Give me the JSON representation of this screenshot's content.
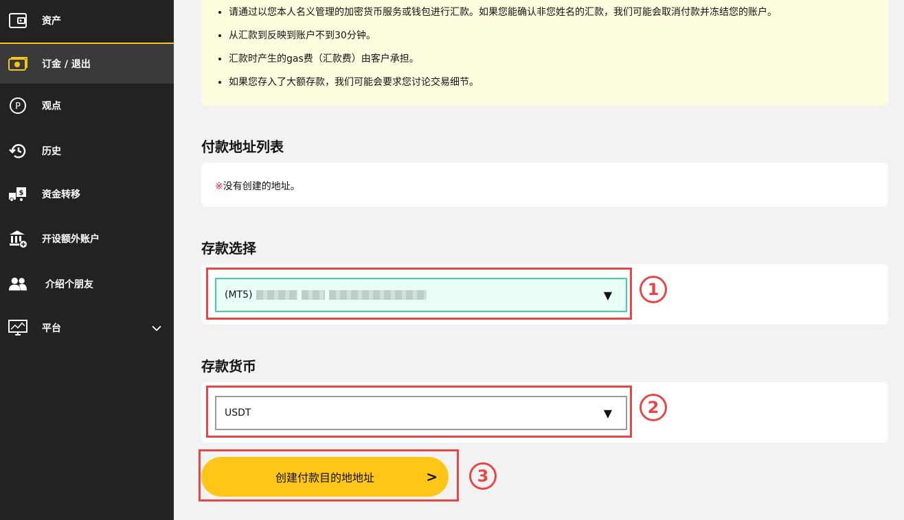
{
  "sidebar": {
    "items": [
      {
        "label": "资产",
        "icon": "wallet-icon"
      },
      {
        "label": "订金 / 退出",
        "icon": "cash-icon"
      },
      {
        "label": "观点",
        "icon": "points-icon"
      },
      {
        "label": "历史",
        "icon": "history-icon"
      },
      {
        "label": "资金转移",
        "icon": "transfer-icon"
      },
      {
        "label": "开设额外账户",
        "icon": "bank-icon"
      },
      {
        "label": "介绍个朋友",
        "icon": "users-icon"
      },
      {
        "label": "平台",
        "icon": "monitor-icon"
      }
    ],
    "active_color": "#f5c518"
  },
  "notice": {
    "items": [
      "请通过以您本人名义管理的加密货币服务或钱包进行汇款。如果您能确认非您姓名的汇款，我们可能会取消付款并冻结您的账户。",
      "从汇款到反映到账户不到30分钟。",
      "汇款时产生的gas费（汇款费）由客户承担。",
      "如果您存入了大额存款，我们可能会要求您讨论交易细节。"
    ]
  },
  "address_list": {
    "title": "付款地址列表",
    "empty_mark": "※",
    "empty_text": "没有创建的地址。"
  },
  "deposit_select": {
    "title": "存款选择",
    "value_prefix": "(MT5)",
    "arrow": "▼",
    "step": "1"
  },
  "currency_select": {
    "title": "存款货币",
    "value": "USDT",
    "arrow": "▼",
    "step": "2"
  },
  "create_button": {
    "label": "创建付款目的地地址",
    "arrow": ">",
    "step": "3"
  },
  "colors": {
    "accent": "#ffc61a",
    "highlight": "#e64646",
    "selected_bg": "#e9fff5"
  }
}
